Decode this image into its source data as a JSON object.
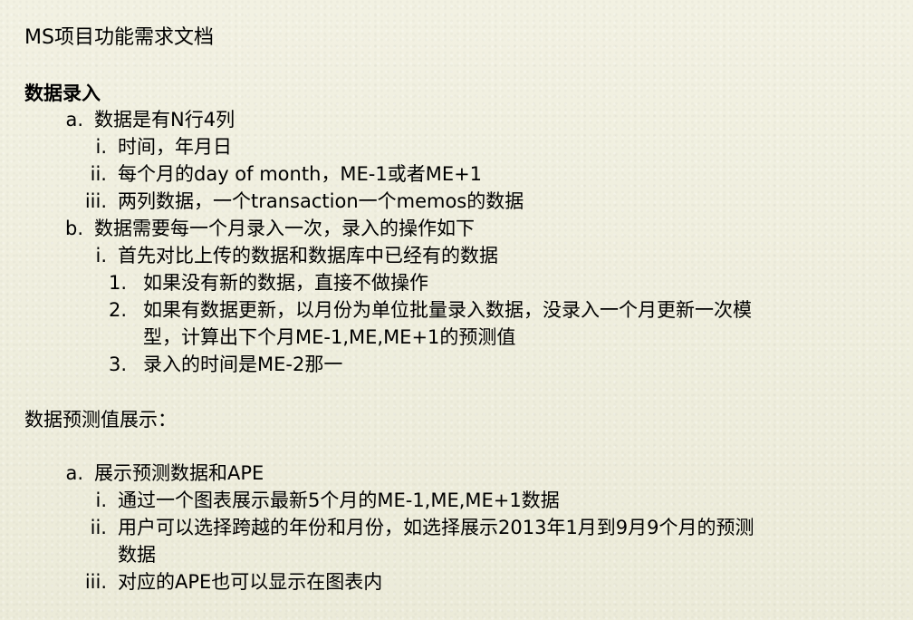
{
  "document": {
    "title": "MS项目功能需求文档",
    "section1": {
      "heading": "数据录入",
      "items": [
        {
          "marker": "a.",
          "text": "数据是有N行4列",
          "subitems": [
            {
              "marker": "i.",
              "text": "时间，年月日"
            },
            {
              "marker": "ii.",
              "text": "每个月的day of month，ME-1或者ME+1"
            },
            {
              "marker": "iii.",
              "text": "两列数据，一个transaction一个memos的数据"
            }
          ]
        },
        {
          "marker": "b.",
          "text": "数据需要每一个月录入一次，录入的操作如下",
          "subitems": [
            {
              "marker": "i.",
              "text": "首先对比上传的数据和数据库中已经有的数据",
              "subitems": [
                {
                  "marker": "1.",
                  "text": "如果没有新的数据，直接不做操作"
                },
                {
                  "marker": "2.",
                  "text_line1": "如果有数据更新，以月份为单位批量录入数据，没录入一个月更新一次模",
                  "text_line2": "型，计算出下个月ME-1,ME,ME+1的预测值"
                },
                {
                  "marker": "3.",
                  "text": "录入的时间是ME-2那一"
                }
              ]
            }
          ]
        }
      ]
    },
    "section2": {
      "heading": "数据预测值展示：",
      "items": [
        {
          "marker": "a.",
          "text": "展示预测数据和APE",
          "subitems": [
            {
              "marker": "i.",
              "text": "通过一个图表展示最新5个月的ME-1,ME,ME+1数据"
            },
            {
              "marker": "ii.",
              "text_line1": "用户可以选择跨越的年份和月份，如选择展示2013年1月到9月9个月的预测",
              "text_line2": "数据"
            },
            {
              "marker": "iii.",
              "text": "对应的APE也可以显示在图表内"
            }
          ]
        }
      ]
    }
  }
}
